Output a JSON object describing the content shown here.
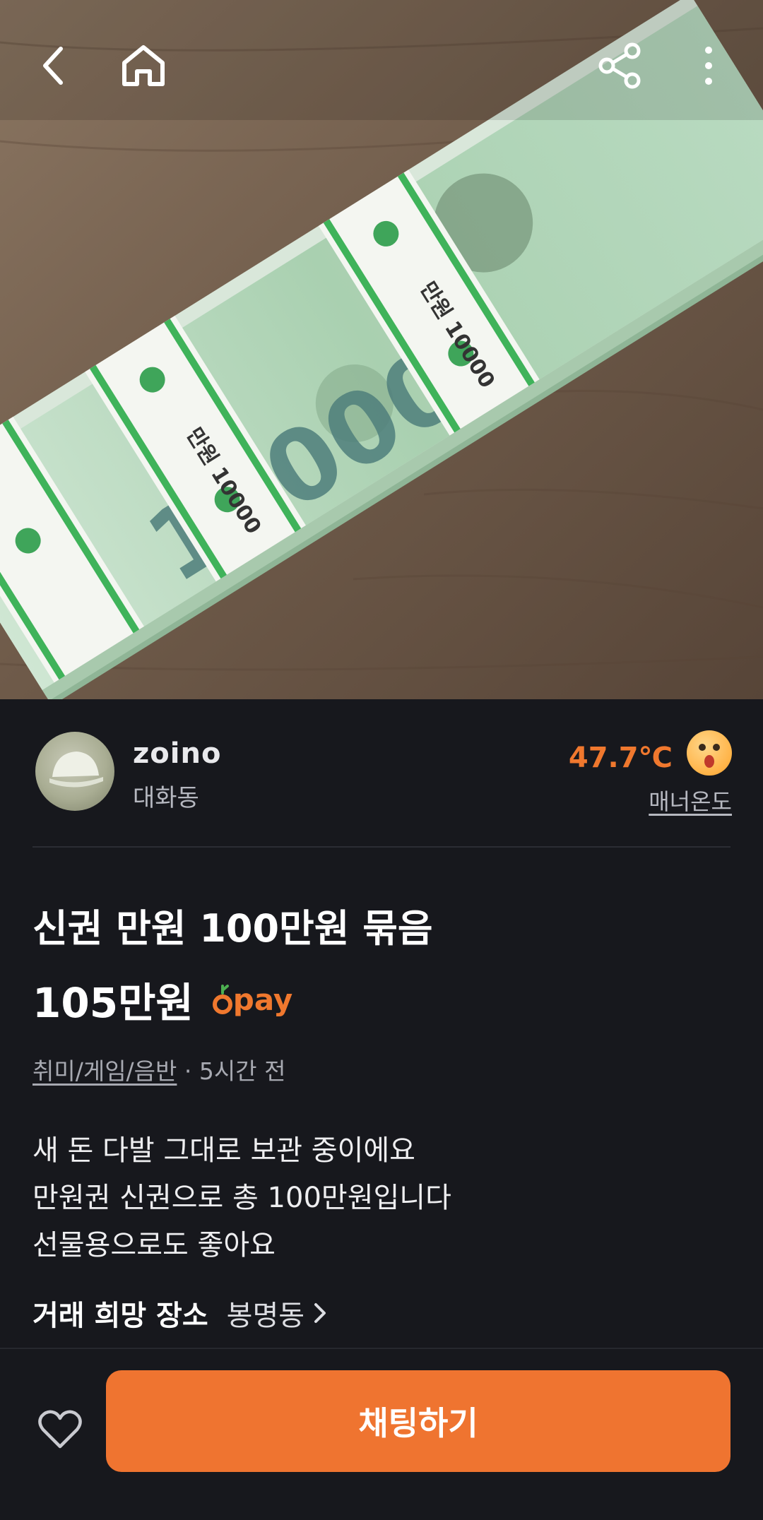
{
  "seller": {
    "name": "zoino",
    "location": "대화동",
    "temperature": "47.7℃",
    "temperature_label": "매너온도"
  },
  "product": {
    "title": "신권 만원 100만원 묶음",
    "price": "105만원",
    "pay_label": "pay",
    "category": "취미/게임/음반",
    "time_ago": "· 5시간 전",
    "description": [
      "새 돈 다발 그대로 보관 중이에요",
      "만원권 신권으로 총 100만원입니다",
      "선물용으로도 좋아요"
    ],
    "trade_place_label": "거래 희망 장소",
    "trade_place": "봉명동"
  },
  "actions": {
    "chat_label": "채팅하기"
  },
  "icons": {
    "back": "back-arrow-icon",
    "home": "home-icon",
    "share": "share-icon",
    "more": "more-vertical-icon",
    "like": "heart-icon",
    "pay": "carrot-icon",
    "temperature_face": "surprised-face-icon"
  },
  "colors": {
    "accent": "#ef7430",
    "background": "#17181d",
    "temperature": "#f0782e"
  }
}
